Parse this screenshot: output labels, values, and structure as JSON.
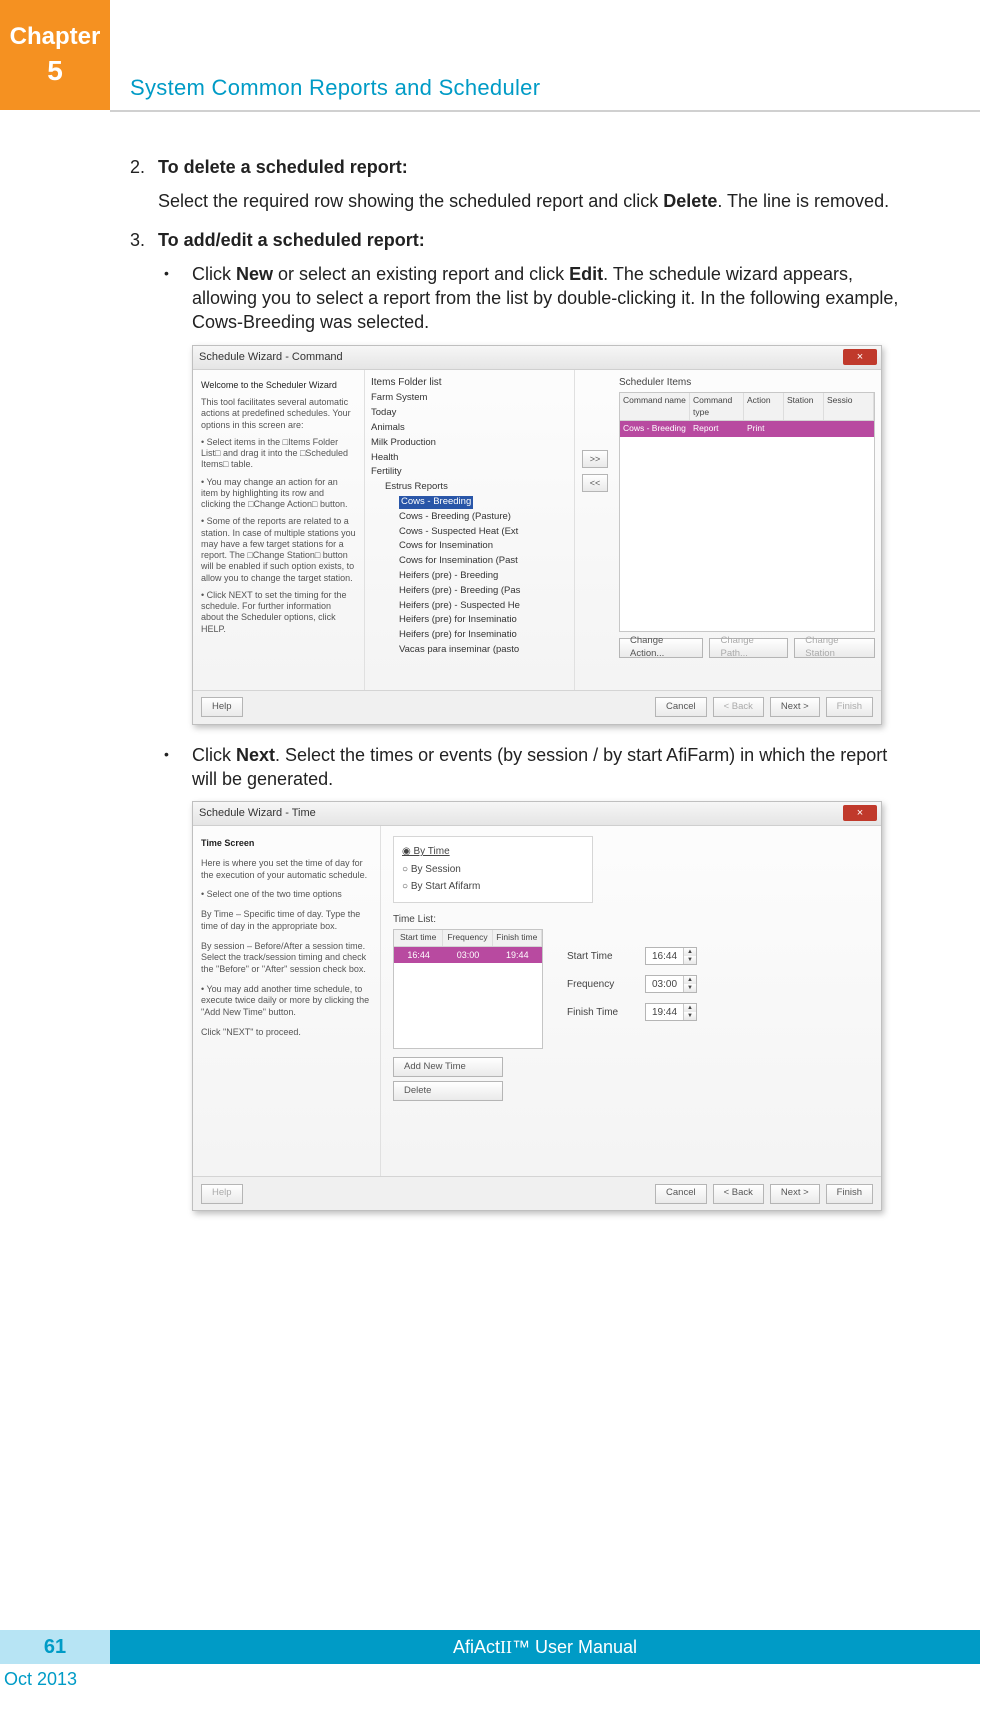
{
  "chapter": {
    "label": "Chapter",
    "number": "5"
  },
  "section_title": "System Common Reports and Scheduler",
  "steps": {
    "s2": {
      "num": "2.",
      "title": "To delete a scheduled report:",
      "body_pre": "Select the required row showing the scheduled report and click ",
      "body_bold": "Delete",
      "body_post": ". The line is removed."
    },
    "s3": {
      "num": "3.",
      "title": "To add/edit a scheduled report:"
    }
  },
  "bullets": {
    "b1": {
      "pre1": "Click ",
      "b1": "New",
      "mid1": " or select an existing report and click ",
      "b2": "Edit",
      "post1": ". The schedule wizard appears, allowing you to select a report from the list by double-clicking it. In the following example, Cows-Breeding was selected."
    },
    "b2": {
      "pre1": "Click ",
      "b1": "Next",
      "post1": ". Select the times or events (by session / by start AfiFarm) in which the report will be generated."
    }
  },
  "dlg1": {
    "title": "Schedule Wizard - Command",
    "close": "×",
    "left_lines": [
      "Welcome to the Scheduler Wizard",
      "This tool facilitates several automatic actions at predefined schedules. Your options in this screen are:",
      "•  Select items in the □Items Folder List□ and drag it into the □Scheduled Items□ table.",
      "•  You may change an action for an item by highlighting its row and clicking the □Change Action□ button.",
      "•  Some of the reports are related to a station. In case of multiple stations you may have a few target stations for a report. The □Change Station□ button will be enabled if such option exists, to allow you to change the target station.",
      "•  Click NEXT to set the timing for the schedule. For further information about the Scheduler options, click HELP."
    ],
    "mid_label": "Items Folder list",
    "tree": [
      "Farm System",
      "Today",
      "Animals",
      "Milk Production",
      "Health",
      "Fertility",
      "  Estrus Reports",
      "    Cows - Breeding",
      "    Cows - Breeding (Pasture)",
      "    Cows - Suspected Heat (Ext",
      "    Cows for Insemination",
      "    Cows for Insemination (Past",
      "    Heifers (pre) - Breeding",
      "    Heifers (pre) - Breeding (Pas",
      "    Heifers (pre) - Suspected He",
      "    Heifers (pre) for Inseminatio",
      "    Heifers (pre) for Inseminatio",
      "    Vacas para inseminar (pasto"
    ],
    "move_btns": {
      "right": ">>",
      "left": "<<"
    },
    "right_label": "Scheduler Items",
    "table_headers": [
      "Command name",
      "Command type",
      "Action",
      "Station",
      "Sessio"
    ],
    "table_row": [
      "Cows - Breeding",
      "Report",
      "Print",
      "",
      ""
    ],
    "under_btns": [
      "Change Action...",
      "Change Path...",
      "Change Station"
    ],
    "footer": {
      "help": "Help",
      "cancel": "Cancel",
      "back": "< Back",
      "next": "Next >",
      "finish": "Finish"
    }
  },
  "dlg2": {
    "title": "Schedule Wizard - Time",
    "close": "×",
    "left_lines": [
      "Time Screen",
      "Here is where you set the time of day for the execution of your automatic schedule.",
      "•  Select one of the two time options",
      "By Time – Specific time of day. Type the time of day in the appropriate box.",
      "By session – Before/After a session time. Select the track/session timing and check the \"Before\" or \"After\" session check box.",
      "•  You may add another time schedule, to execute twice daily or more by clicking the \"Add New Time\" button.",
      "Click \"NEXT\" to proceed."
    ],
    "radios": [
      "By Time",
      "By Session",
      "By Start Afifarm"
    ],
    "radio_selected": 0,
    "timelist_label": "Time List:",
    "timelist_headers": [
      "Start time",
      "Frequency",
      "Finish time"
    ],
    "timelist_row": [
      "16:44",
      "03:00",
      "19:44"
    ],
    "fields": {
      "start": {
        "label": "Start Time",
        "value": "16:44"
      },
      "freq": {
        "label": "Frequency",
        "value": "03:00"
      },
      "finish": {
        "label": "Finish Time",
        "value": "19:44"
      }
    },
    "btns": {
      "add": "Add New Time",
      "del": "Delete"
    },
    "footer": {
      "help": "Help",
      "cancel": "Cancel",
      "back": "< Back",
      "next": "Next >",
      "finish": "Finish"
    }
  },
  "footer": {
    "page": "61",
    "title_pre": "AfiAct ",
    "title_roman": "II",
    "title_post": "™ User Manual",
    "date": "Oct 2013"
  }
}
